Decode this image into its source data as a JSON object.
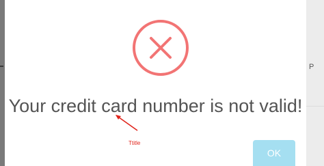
{
  "alert": {
    "message": "Your credit card number is not valid!",
    "icon": "error-x-icon",
    "ok_label": "OK"
  },
  "annotation": {
    "label": "Ttitle"
  },
  "backdrop": {
    "right_partial_text": "P"
  },
  "colors": {
    "error": "#f27474",
    "button": "#a5dff1",
    "annotation": "#e0241b",
    "message_text": "#545454"
  }
}
